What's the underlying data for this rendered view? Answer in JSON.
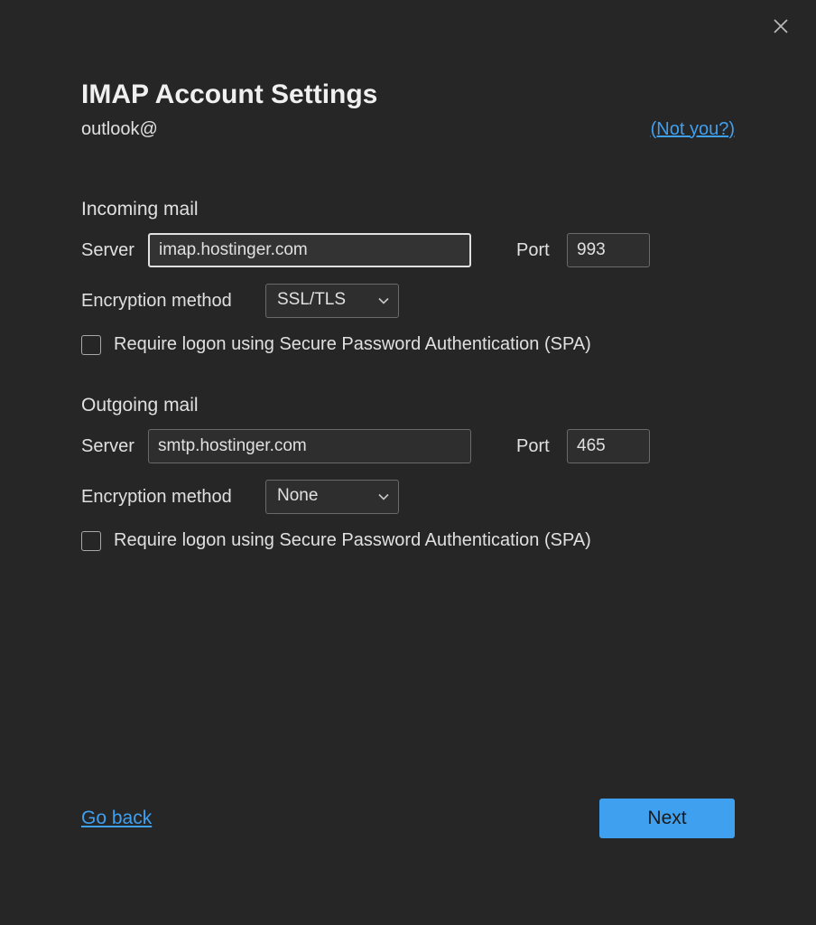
{
  "header": {
    "title": "IMAP Account Settings",
    "email_prefix": "outlook@",
    "not_you": "(Not you?)"
  },
  "incoming": {
    "title": "Incoming mail",
    "server_label": "Server",
    "server_value": "imap.hostinger.com",
    "port_label": "Port",
    "port_value": "993",
    "encryption_label": "Encryption method",
    "encryption_value": "SSL/TLS",
    "spa_label": "Require logon using Secure Password Authentication (SPA)"
  },
  "outgoing": {
    "title": "Outgoing mail",
    "server_label": "Server",
    "server_value": "smtp.hostinger.com",
    "port_label": "Port",
    "port_value": "465",
    "encryption_label": "Encryption method",
    "encryption_value": "None",
    "spa_label": "Require logon using Secure Password Authentication (SPA)"
  },
  "footer": {
    "go_back": "Go back",
    "next": "Next"
  }
}
